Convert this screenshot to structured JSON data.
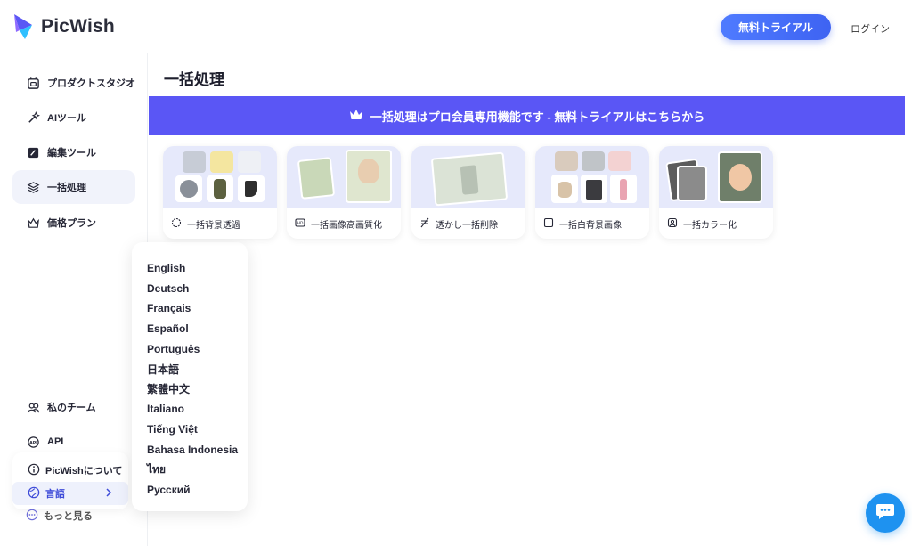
{
  "brand": {
    "name": "PicWish"
  },
  "header": {
    "trial_button": "無料トライアル",
    "login": "ログイン"
  },
  "sidebar": {
    "items": [
      {
        "label": "プロダクトスタジオ",
        "icon": "studio-icon"
      },
      {
        "label": "AIツール",
        "icon": "ai-magic-icon"
      },
      {
        "label": "編集ツール",
        "icon": "edit-icon"
      },
      {
        "label": "一括処理",
        "icon": "layers-icon",
        "active": true
      },
      {
        "label": "価格プラン",
        "icon": "crown-icon"
      }
    ],
    "bottom_items": [
      {
        "label": "私のチーム",
        "icon": "team-icon"
      },
      {
        "label": "API",
        "icon": "api-icon"
      }
    ],
    "popup": {
      "about": "PicWishについて",
      "language": "言語",
      "more": "もっと見る"
    }
  },
  "language_menu": [
    "English",
    "Deutsch",
    "Français",
    "Español",
    "Português",
    "日本語",
    "繁體中文",
    "Italiano",
    "Tiếng Việt",
    "Bahasa Indonesia",
    "ไทย",
    "Русский"
  ],
  "main": {
    "title": "一括処理",
    "banner": "一括処理はプロ会員専用機能です - 無料トライアルはこちらから",
    "cards": [
      {
        "label": "一括背景透過",
        "icon": "bg-remove-icon"
      },
      {
        "label": "一括画像高画質化",
        "icon": "hd-icon"
      },
      {
        "label": "透かし一括削除",
        "icon": "watermark-remove-icon"
      },
      {
        "label": "一括白背景画像",
        "icon": "white-bg-icon"
      },
      {
        "label": "一括カラー化",
        "icon": "colorize-icon"
      }
    ]
  },
  "colors": {
    "accent": "#5a56f5",
    "primary_button": "#3e63f2",
    "chat": "#1e92f0"
  }
}
